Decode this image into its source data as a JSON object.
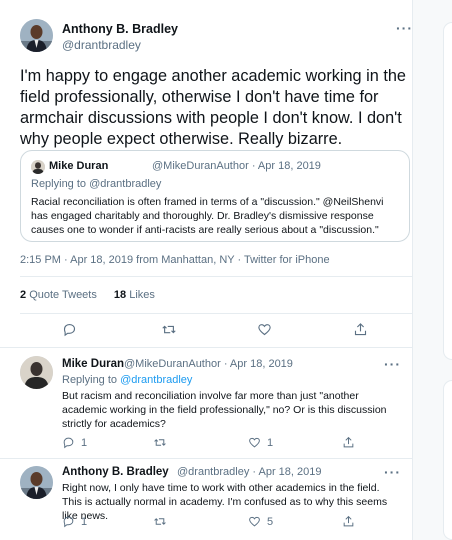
{
  "main_tweet": {
    "author_name": "Anthony B. Bradley",
    "author_handle": "@drantbradley",
    "more": "···",
    "text": "I'm happy to engage another academic working in the field professionally, otherwise I don't have time for armchair discussions with people I don't know. I don't why people expect otherwise. Really bizarre.",
    "meta": "2:15 PM · Apr 18, 2019 from Manhattan, NY · Twitter for iPhone",
    "quote_tweets_count": "2",
    "quote_tweets_label": "Quote Tweets",
    "likes_count": "18",
    "likes_label": "Likes"
  },
  "quoted_tweet": {
    "author_name": "Mike Duran",
    "meta": "@MikeDuranAuthor · Apr 18, 2019",
    "replying_to": "Replying to @drantbradley",
    "text": "Racial reconciliation is often framed in terms of a \"discussion.\"  @NeilShenvi has engaged charitably and thoroughly. Dr. Bradley's dismissive response causes one to wonder if anti-racists are really serious about a \"discussion.\""
  },
  "replies": [
    {
      "author_name": "Mike Duran",
      "meta": "@MikeDuranAuthor · Apr 18, 2019",
      "replying_prefix": "Replying to",
      "replying_handle": "@drantbradley",
      "more": "···",
      "text": "But racism and reconciliation involve far more than just \"another academic working in the field professionally,\" no? Or is this discussion strictly for academics?",
      "reply_count": "1",
      "retweet_count": "",
      "like_count": "1"
    },
    {
      "author_name": "Anthony B. Bradley",
      "meta": "@drantbradley · Apr 18, 2019",
      "more": "···",
      "text": "Right now, I only have time to work with other academics in the field. This is actually normal in academy. I'm confused as to why this seems like news.",
      "reply_count": "1",
      "retweet_count": "",
      "like_count": "5"
    }
  ],
  "colors": {
    "accent": "#1d9bf0",
    "secondary_text": "#5b7083",
    "border": "#e6ecf0"
  }
}
